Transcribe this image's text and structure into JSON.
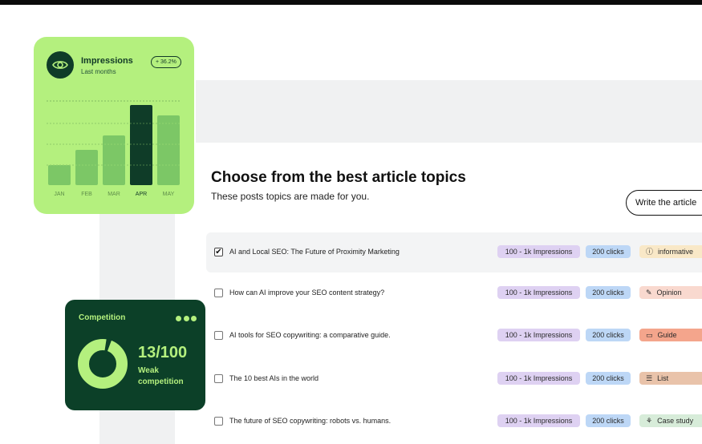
{
  "impressions": {
    "title": "Impressions",
    "subtitle": "Last months",
    "change": "+ 36.2%",
    "accent_color": "#b4f07e",
    "dark_color": "#0f3c28",
    "icon": "eye-icon"
  },
  "chart_data": {
    "type": "bar",
    "categories": [
      "JAN",
      "FEB",
      "MAR",
      "APR",
      "MAY"
    ],
    "values": [
      25,
      44,
      62,
      100,
      87
    ],
    "highlight": "APR",
    "grid": true,
    "title": "",
    "xlabel": "",
    "ylabel": ""
  },
  "main": {
    "title": "Choose from the best article topics",
    "subtitle": "These posts topics are made for you.",
    "write_button": "Write the article"
  },
  "topics": [
    {
      "title": "AI and Local SEO: The Future of Proximity Marketing",
      "checked": true,
      "impressions": "100 - 1k Impressions",
      "clicks": "200 clicks",
      "type": "informative",
      "type_icon": "info-icon",
      "type_glyph": "ⓘ",
      "type_color": "#f9e8c7"
    },
    {
      "title": "How can AI improve your SEO content strategy?",
      "checked": false,
      "impressions": "100 - 1k Impressions",
      "clicks": "200 clicks",
      "type": "Opinion",
      "type_icon": "megaphone-icon",
      "type_glyph": "✎",
      "type_color": "#f9d9cf"
    },
    {
      "title": "AI tools for SEO copywriting: a comparative guide.",
      "checked": false,
      "impressions": "100 - 1k Impressions",
      "clicks": "200 clicks",
      "type": "Guide",
      "type_icon": "book-icon",
      "type_glyph": "▭",
      "type_color": "#f4a58c"
    },
    {
      "title": "The 10 best AIs in the world",
      "checked": false,
      "impressions": "100 - 1k Impressions",
      "clicks": "200 clicks",
      "type": "List",
      "type_icon": "list-icon",
      "type_glyph": "☰",
      "type_color": "#e9c3aa"
    },
    {
      "title": "The future of SEO copywriting: robots vs. humans.",
      "checked": false,
      "impressions": "100 - 1k Impressions",
      "clicks": "200 clicks",
      "type": "Case study",
      "type_icon": "case-study-icon",
      "type_glyph": "⚘",
      "type_color": "#d7ecd9"
    }
  ],
  "competition": {
    "title": "Competition",
    "score": "13/100",
    "label": "Weak competition",
    "level": 0.13,
    "menu_icon": "more-dots-icon"
  }
}
